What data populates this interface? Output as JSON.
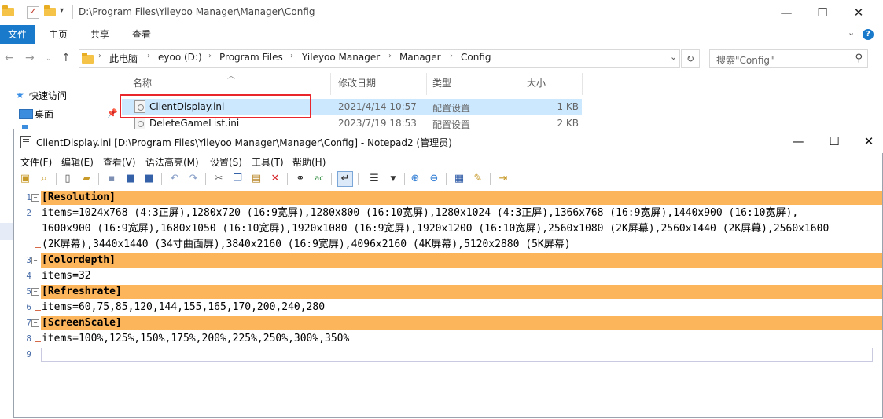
{
  "explorer": {
    "title_path": "D:\\Program Files\\Yileyoo Manager\\Manager\\Config",
    "ribbon_tabs": [
      "文件",
      "主页",
      "共享",
      "查看"
    ],
    "breadcrumbs": [
      "此电脑",
      "eyoo (D:)",
      "Program Files",
      "Yileyoo Manager",
      "Manager",
      "Config"
    ],
    "search_placeholder": "搜索\"Config\"",
    "nav_quick_access": "快速访问",
    "nav_desktop": "桌面",
    "columns": [
      "名称",
      "修改日期",
      "类型",
      "大小"
    ],
    "files": [
      {
        "name": "ClientDisplay.ini",
        "date": "2021/4/14 10:57",
        "type": "配置设置",
        "size": "1 KB"
      },
      {
        "name": "DeleteGameList.ini",
        "date": "2023/7/19 18:53",
        "type": "配置设置",
        "size": "2 KB"
      }
    ],
    "accent_color": "#1979ca",
    "highlight_color": "#e8262b"
  },
  "notepad": {
    "title": "ClientDisplay.ini [D:\\Program Files\\Yileyoo Manager\\Manager\\Config] - Notepad2 (管理员)",
    "menu": [
      "文件(F)",
      "编辑(E)",
      "查看(V)",
      "语法高亮(M)",
      "设置(S)",
      "工具(T)",
      "帮助(H)"
    ],
    "lines": [
      {
        "num": "1",
        "text": "[Resolution]"
      },
      {
        "num": "2",
        "text": "items=1024x768 (4:3正屏),1280x720 (16:9宽屏),1280x800 (16:10宽屏),1280x1024 (4:3正屏),1366x768 (16:9宽屏),1440x900 (16:10宽屏),"
      },
      {
        "num": "",
        "text": "1600x900 (16:9宽屏),1680x1050 (16:10宽屏),1920x1080 (16:9宽屏),1920x1200 (16:10宽屏),2560x1080 (2K屏幕),2560x1440 (2K屏幕),2560x1600"
      },
      {
        "num": "",
        "text": "(2K屏幕),3440x1440 (34寸曲面屏),3840x2160 (16:9宽屏),4096x2160 (4K屏幕),5120x2880 (5K屏幕)"
      },
      {
        "num": "3",
        "text": "[Colordepth]"
      },
      {
        "num": "4",
        "text": "items=32"
      },
      {
        "num": "5",
        "text": "[Refreshrate]"
      },
      {
        "num": "6",
        "text": "items=60,75,85,120,144,155,165,170,200,240,280"
      },
      {
        "num": "7",
        "text": "[ScreenScale]"
      },
      {
        "num": "8",
        "text": "items=100%,125%,150%,175%,200%,225%,250%,300%,350%"
      },
      {
        "num": "9",
        "text": ""
      }
    ],
    "section_color": "#fdb55c"
  }
}
